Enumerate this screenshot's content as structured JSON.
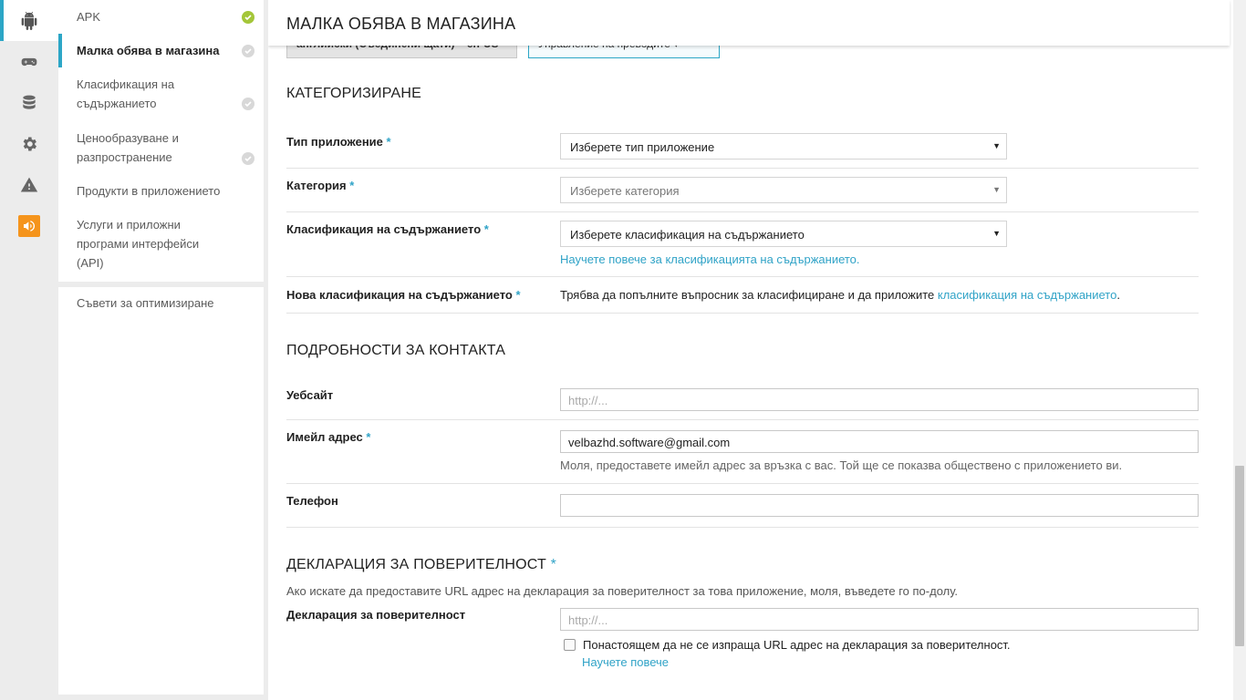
{
  "rail": {
    "items": [
      {
        "icon": "android-icon",
        "active": true
      },
      {
        "icon": "gamepad-icon"
      },
      {
        "icon": "database-icon"
      },
      {
        "icon": "gear-icon"
      },
      {
        "icon": "warning-icon"
      },
      {
        "icon": "promo-icon"
      }
    ]
  },
  "nav": {
    "items": [
      {
        "label": "APK",
        "status": "complete"
      },
      {
        "label": "Малка обява в магазина",
        "status": "pending"
      },
      {
        "label": "Класификация на съдържанието",
        "status": "pending"
      },
      {
        "label": "Ценообразуване и разпространение",
        "status": "pending"
      },
      {
        "label": "Продукти в приложението"
      },
      {
        "label": "Услуги и приложни програми интерфейси (API)"
      }
    ],
    "tips": "Съвети за оптимизиране"
  },
  "header": {
    "title": "МАЛКА ОБЯВА В МАГАЗИНА"
  },
  "toolbar": {
    "language_button": "английски (Съединени щати) – en-US",
    "translations_button": "Управление на преводите ▾"
  },
  "categorization": {
    "title": "КАТЕГОРИЗИРАНЕ",
    "app_type_label": "Тип приложение",
    "app_type_value": "Изберете тип приложение",
    "category_label": "Категория",
    "category_value": "Изберете категория",
    "rating_label": "Класификация на съдържанието",
    "rating_value": "Изберете класификация на съдържанието",
    "rating_link": "Научете повече за класификацията на съдържанието.",
    "new_rating_label": "Нова класификация на съдържанието",
    "new_rating_text": "Трябва да попълните въпросник за класифициране и да приложите",
    "new_rating_link": "класификация на съдържанието",
    "new_rating_end": "."
  },
  "contact": {
    "title": "ПОДРОБНОСТИ ЗА КОНТАКТА",
    "website_label": "Уебсайт",
    "website_placeholder": "http://...",
    "email_label": "Имейл адрес",
    "email_value": "velbazhd.software@gmail.com",
    "email_help": "Моля, предоставете имейл адрес за връзка с вас. Той ще се показва обществено с приложението ви.",
    "phone_label": "Телефон",
    "phone_value": ""
  },
  "privacy": {
    "title": "ДЕКЛАРАЦИЯ ЗА ПОВЕРИТЕЛНОСТ",
    "description": "Ако искате да предоставите URL адрес на декларация за поверителност за това приложение, моля, въведете го по-долу.",
    "label": "Декларация за поверителност",
    "placeholder": "http://...",
    "checkbox_label": "Понастоящем да не се изпраща URL адрес на декларация за поверителност.",
    "checked": false,
    "learn_more": "Научете повече"
  },
  "required_mark": "*",
  "colors": {
    "accent": "#2ca6c6",
    "link": "#30a3c7",
    "complete": "#a4c639",
    "promo": "#f5941c"
  }
}
